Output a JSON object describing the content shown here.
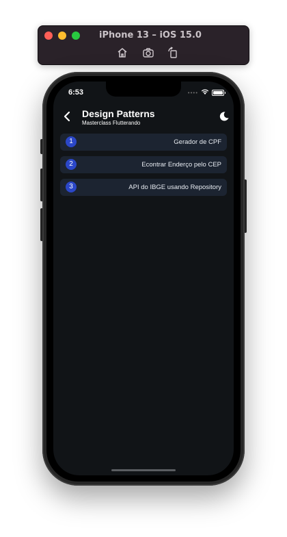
{
  "simulator": {
    "title": "iPhone 13 – iOS 15.0",
    "toolbar": [
      "home-icon",
      "screenshot-icon",
      "rotate-icon"
    ]
  },
  "status_bar": {
    "time": "6:53",
    "icons": [
      "signal-icon",
      "wifi-icon",
      "battery-icon"
    ]
  },
  "app_bar": {
    "title": "Design Patterns",
    "subtitle": "Masterclass Flutterando",
    "back_icon": "chevron-left-icon",
    "theme_icon": "moon-icon"
  },
  "patterns": [
    {
      "number": "1",
      "title": "Gerador de CPF"
    },
    {
      "number": "2",
      "title": "Econtrar Enderço pelo CEP"
    },
    {
      "number": "3",
      "title": "API do IBGE usando Repository"
    }
  ],
  "colors": {
    "screen_background": "#111417",
    "card_background": "#1c2431",
    "badge_accent": "#2b47c7"
  }
}
